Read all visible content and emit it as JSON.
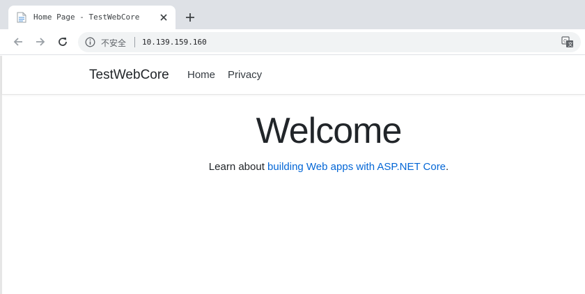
{
  "browser": {
    "tab": {
      "title": "Home Page - TestWebCore"
    },
    "omnibox": {
      "security_label": "不安全",
      "url": "10.139.159.160"
    },
    "icons": {
      "favicon": "document-icon",
      "tab_close": "close-icon",
      "new_tab": "plus-icon",
      "back": "arrow-left-icon",
      "forward": "arrow-right-icon",
      "reload": "reload-icon",
      "info": "info-icon",
      "translate": "translate-icon"
    }
  },
  "site": {
    "brand": "TestWebCore",
    "nav": [
      {
        "label": "Home"
      },
      {
        "label": "Privacy"
      }
    ],
    "heading": "Welcome",
    "intro": {
      "prefix": "Learn about ",
      "link": "building Web apps with ASP.NET Core",
      "suffix": "."
    }
  },
  "colors": {
    "tabstrip": "#dee1e6",
    "omnibox": "#f1f3f4",
    "link": "#0366d6",
    "text": "#212529"
  }
}
